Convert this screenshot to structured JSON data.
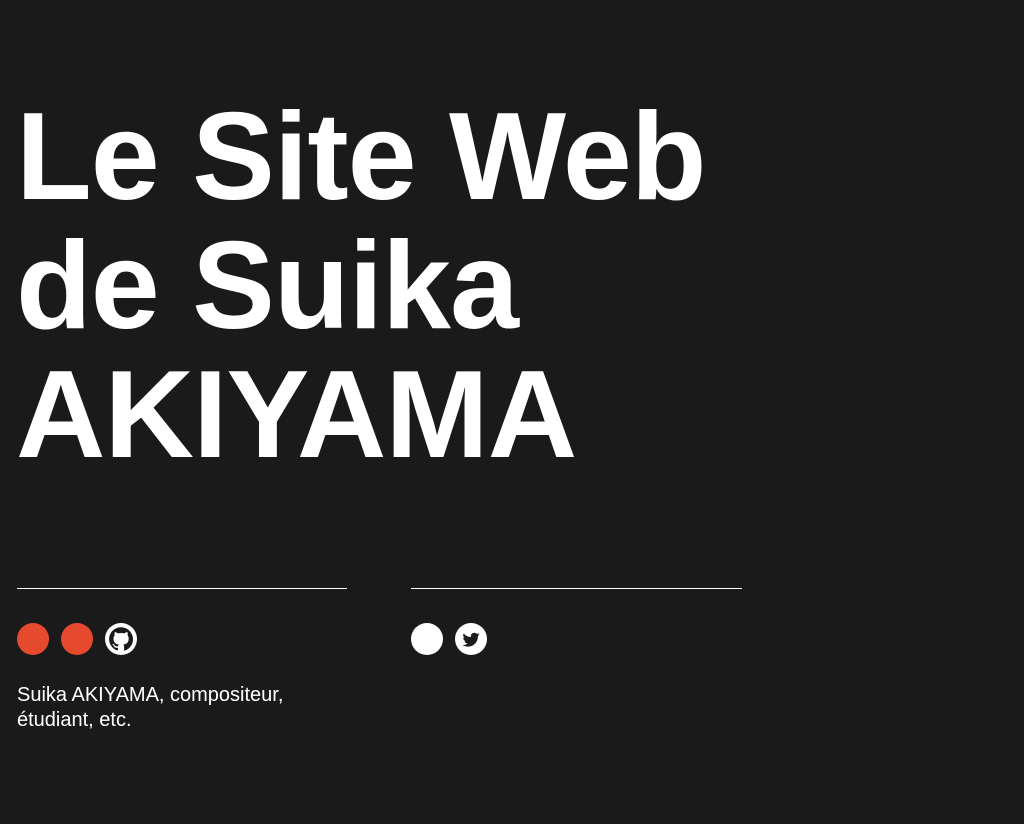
{
  "title": {
    "line1": "Le Site Web",
    "line2": "de Suika",
    "line3": "AKIYAMA"
  },
  "left_column": {
    "icons": [
      {
        "name": "red-dot-icon",
        "color": "#e64a2e"
      },
      {
        "name": "red-dot-icon",
        "color": "#e64a2e"
      },
      {
        "name": "github-icon",
        "color": "#ffffff"
      }
    ],
    "bio_line1": "Suika AKIYAMA, compositeur,",
    "bio_line2": "étudiant, etc."
  },
  "right_column": {
    "icons": [
      {
        "name": "white-dot-icon",
        "color": "#ffffff"
      },
      {
        "name": "twitter-icon",
        "color": "#ffffff"
      }
    ]
  },
  "colors": {
    "background": "#1a1a1a",
    "text": "#ffffff",
    "accent": "#e64a2e"
  }
}
